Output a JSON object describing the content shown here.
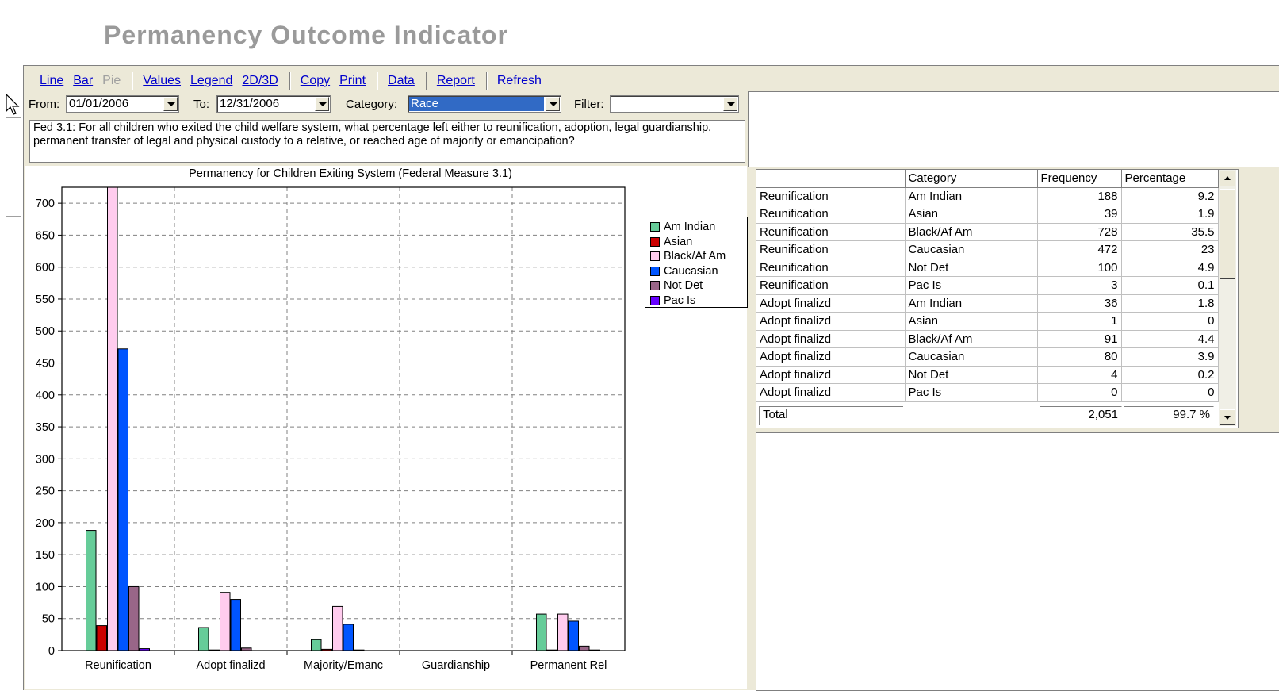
{
  "title": "Permanency Outcome Indicator",
  "toolbar": {
    "line": "Line",
    "bar": "Bar",
    "pie": "Pie",
    "values": "Values",
    "legend": "Legend",
    "dim": "2D/3D",
    "copy": "Copy",
    "print": "Print",
    "data": "Data",
    "report": "Report",
    "refresh": "Refresh"
  },
  "filters": {
    "from_label": "From:",
    "from_value": "01/01/2006",
    "to_label": "To:",
    "to_value": "12/31/2006",
    "category_label": "Category:",
    "category_value": "Race",
    "filter_label": "Filter:",
    "filter_value": ""
  },
  "question": "Fed 3.1: For all children who exited the child welfare system, what percentage left either to reunification, adoption, legal guardianship, permanent transfer of legal and physical custody to a relative, or reached age of majority or emancipation?",
  "chart_data": {
    "type": "bar",
    "title": "Permanency for Children Exiting System (Federal Measure 3.1)",
    "categories": [
      "Reunification",
      "Adopt finalizd",
      "Majority/Emanc",
      "Guardianship",
      "Permanent Rel"
    ],
    "series": [
      {
        "name": "Am Indian",
        "color": "#66cc99",
        "values": [
          188,
          36,
          17,
          0,
          57
        ]
      },
      {
        "name": "Asian",
        "color": "#cc0000",
        "values": [
          39,
          1,
          2,
          0,
          1
        ]
      },
      {
        "name": "Black/Af Am",
        "color": "#ffccee",
        "values": [
          728,
          91,
          69,
          0,
          57
        ]
      },
      {
        "name": "Caucasian",
        "color": "#0055ff",
        "values": [
          472,
          80,
          41,
          0,
          46
        ]
      },
      {
        "name": "Not Det",
        "color": "#996688",
        "values": [
          100,
          4,
          1,
          0,
          7
        ]
      },
      {
        "name": "Pac Is",
        "color": "#6600ff",
        "values": [
          3,
          0,
          0,
          0,
          1
        ]
      }
    ],
    "ylim": [
      0,
      725
    ],
    "yticks": [
      "0",
      "50",
      "100",
      "150",
      "200",
      "250",
      "300",
      "350",
      "400",
      "450",
      "500",
      "550",
      "600",
      "650",
      "700"
    ],
    "grid": true,
    "legend_position": "right"
  },
  "table": {
    "headers": [
      "",
      "Category",
      "Frequency",
      "Percentage"
    ],
    "rows": [
      [
        "Reunification",
        "Am Indian",
        "188",
        "9.2"
      ],
      [
        "Reunification",
        "Asian",
        "39",
        "1.9"
      ],
      [
        "Reunification",
        "Black/Af Am",
        "728",
        "35.5"
      ],
      [
        "Reunification",
        "Caucasian",
        "472",
        "23"
      ],
      [
        "Reunification",
        "Not Det",
        "100",
        "4.9"
      ],
      [
        "Reunification",
        "Pac Is",
        "3",
        "0.1"
      ],
      [
        "Adopt finalizd",
        "Am Indian",
        "36",
        "1.8"
      ],
      [
        "Adopt finalizd",
        "Asian",
        "1",
        "0"
      ],
      [
        "Adopt finalizd",
        "Black/Af Am",
        "91",
        "4.4"
      ],
      [
        "Adopt finalizd",
        "Caucasian",
        "80",
        "3.9"
      ],
      [
        "Adopt finalizd",
        "Not Det",
        "4",
        "0.2"
      ],
      [
        "Adopt finalizd",
        "Pac Is",
        "0",
        "0"
      ]
    ],
    "total_label": "Total",
    "total_frequency": "2,051",
    "total_percentage": "99.7 %"
  }
}
